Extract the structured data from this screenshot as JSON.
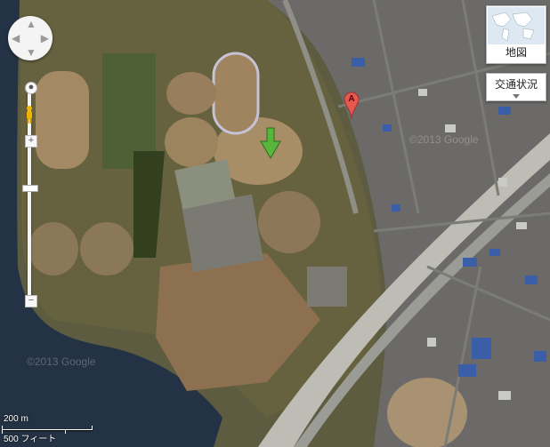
{
  "controls": {
    "overview_label": "地図",
    "traffic_label": "交通状況"
  },
  "scale": {
    "metric": "200 m",
    "imperial": "500 フィート"
  },
  "marker": {
    "label": "A"
  },
  "watermarks": [
    "©2013 Google",
    "©2013 Google"
  ],
  "colors": {
    "river": "#233244",
    "field_dirt": "#a48a64",
    "grass": "#5f6a3a",
    "road": "#bdbdb5",
    "marker_red": "#e55a4f",
    "arrow_green": "#56b53a"
  }
}
